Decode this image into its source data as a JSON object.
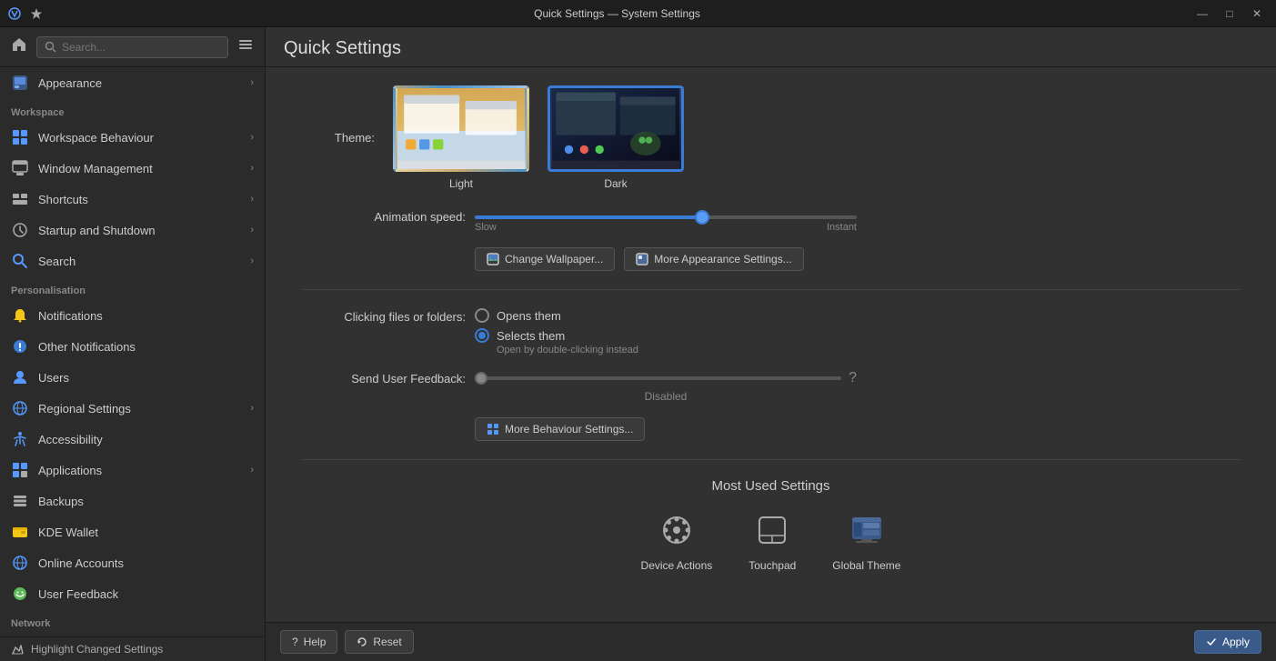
{
  "window": {
    "title": "Quick Settings — System Settings"
  },
  "titlebar": {
    "icons": [
      "kde-icon",
      "star-icon"
    ],
    "controls": {
      "minimize": "—",
      "maximize": "□",
      "close": "✕"
    }
  },
  "sidebar": {
    "search_placeholder": "Search...",
    "top_items": [
      {
        "id": "appearance",
        "label": "Appearance",
        "icon": "🎨",
        "has_arrow": true,
        "active": false
      }
    ],
    "sections": [
      {
        "header": "Workspace",
        "items": [
          {
            "id": "workspace-behaviour",
            "label": "Workspace Behaviour",
            "icon": "💠",
            "has_arrow": true
          },
          {
            "id": "window-management",
            "label": "Window Management",
            "icon": "🪟",
            "has_arrow": true
          },
          {
            "id": "shortcuts",
            "label": "Shortcuts",
            "icon": "⌨",
            "has_arrow": true
          },
          {
            "id": "startup-shutdown",
            "label": "Startup and Shutdown",
            "icon": "🔄",
            "has_arrow": true
          },
          {
            "id": "search",
            "label": "Search",
            "icon": "🔍",
            "has_arrow": true
          }
        ]
      },
      {
        "header": "Personalisation",
        "items": [
          {
            "id": "notifications",
            "label": "Notifications",
            "icon": "🔔",
            "has_arrow": false
          },
          {
            "id": "other-notifications",
            "label": "Other Notifications",
            "icon": "🔵",
            "has_arrow": false
          },
          {
            "id": "users",
            "label": "Users",
            "icon": "👤",
            "has_arrow": false
          },
          {
            "id": "regional-settings",
            "label": "Regional Settings",
            "icon": "🌐",
            "has_arrow": true
          },
          {
            "id": "accessibility",
            "label": "Accessibility",
            "icon": "♿",
            "has_arrow": false
          },
          {
            "id": "applications",
            "label": "Applications",
            "icon": "📱",
            "has_arrow": true
          },
          {
            "id": "backups",
            "label": "Backups",
            "icon": "🗄",
            "has_arrow": false
          },
          {
            "id": "kde-wallet",
            "label": "KDE Wallet",
            "icon": "💳",
            "has_arrow": false
          },
          {
            "id": "online-accounts",
            "label": "Online Accounts",
            "icon": "🌐",
            "has_arrow": false
          },
          {
            "id": "user-feedback",
            "label": "User Feedback",
            "icon": "💬",
            "has_arrow": false
          }
        ]
      },
      {
        "header": "Network",
        "items": []
      }
    ],
    "highlight_label": "Highlight Changed Settings"
  },
  "main": {
    "title": "Quick Settings",
    "theme": {
      "label": "Theme:",
      "options": [
        {
          "id": "light",
          "label": "Light",
          "selected": false
        },
        {
          "id": "dark",
          "label": "Dark",
          "selected": true
        }
      ]
    },
    "animation_speed": {
      "label": "Animation speed:",
      "min_label": "Slow",
      "max_label": "Instant",
      "value": 60
    },
    "buttons": {
      "change_wallpaper": "Change Wallpaper...",
      "more_appearance": "More Appearance Settings..."
    },
    "clicking_files": {
      "label": "Clicking files or folders:",
      "options": [
        {
          "id": "opens",
          "label": "Opens them",
          "selected": false
        },
        {
          "id": "selects",
          "label": "Selects them",
          "selected": true
        }
      ],
      "sublabel": "Open by double-clicking instead"
    },
    "feedback": {
      "label": "Send User Feedback:",
      "status": "Disabled"
    },
    "more_behaviour_btn": "More Behaviour Settings...",
    "most_used": {
      "title": "Most Used Settings",
      "items": [
        {
          "id": "device-actions",
          "label": "Device Actions",
          "icon": "⚙"
        },
        {
          "id": "touchpad",
          "label": "Touchpad",
          "icon": "🖱"
        },
        {
          "id": "global-theme",
          "label": "Global Theme",
          "icon": "🖥"
        }
      ]
    }
  },
  "footer": {
    "help_label": "Help",
    "reset_label": "Reset",
    "apply_label": "Apply"
  }
}
